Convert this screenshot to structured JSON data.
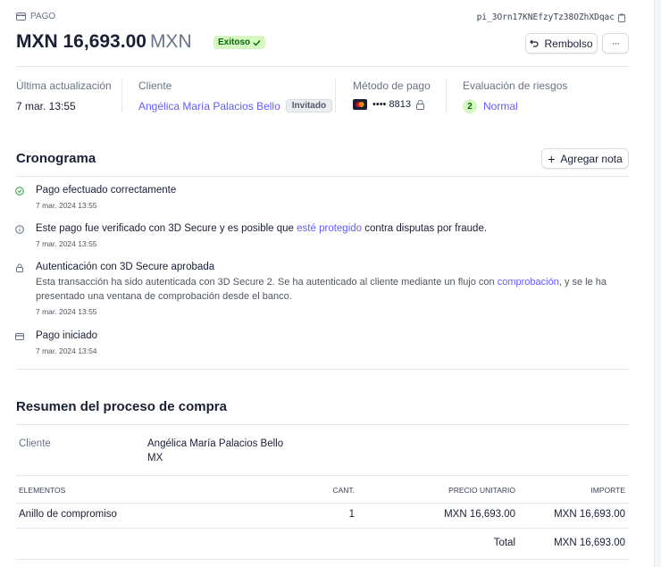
{
  "header": {
    "label": "PAGO",
    "id": "pi_3Orn17KNEfzyTz38OZhXDqac",
    "amount": "MXN 16,693.00",
    "currency": "MXN",
    "status": "Exitoso",
    "refund_label": "Rembolso",
    "more_label": "···"
  },
  "summary": {
    "updated_label": "Última actualización",
    "updated_value": "7 mar. 13:55",
    "client_label": "Cliente",
    "client_name": "Angélica María Palacios Bello",
    "client_badge": "Invitado",
    "method_label": "Método de pago",
    "method_value": "•••• 8813",
    "risk_label": "Evaluación de riesgos",
    "risk_score": "2",
    "risk_value": "Normal"
  },
  "timeline": {
    "title": "Cronograma",
    "add_note": "Agregar nota",
    "events": [
      {
        "title": "Pago efectuado correctamente",
        "date": "7 mar. 2024 13:55"
      },
      {
        "title_pre": "Este pago fue verificado con 3D Secure y es posible que ",
        "title_link": "esté protegido",
        "title_post": " contra disputas por fraude.",
        "date": "7 mar. 2024 13:55"
      },
      {
        "title": "Autenticación con 3D Secure aprobada",
        "body_pre": "Esta transacción ha sido autenticada con 3D Secure 2. Se ha autenticado al cliente mediante un flujo con ",
        "body_link": "comprobación",
        "body_post": ", y se le ha",
        "body_line2": "presentado una ventana de comprobación desde el banco.",
        "date": "7 mar. 2024 13:55"
      },
      {
        "title": "Pago iniciado",
        "date": "7 mar. 2024 13:54"
      }
    ]
  },
  "checkout": {
    "title": "Resumen del proceso de compra",
    "client_label": "Cliente",
    "client_name": "Angélica María Palacios Bello",
    "client_country": "MX",
    "columns": [
      "ELEMENTOS",
      "CANT.",
      "PRECIO UNITARIO",
      "IMPORTE"
    ],
    "items": [
      {
        "name": "Anillo de compromiso",
        "qty": "1",
        "unit": "MXN 16,693.00",
        "total": "MXN 16,693.00"
      }
    ],
    "total_label": "Total",
    "total_value": "MXN 16,693.00"
  },
  "colors": {
    "accent": "#635bff",
    "success_bg": "#d7f7c2",
    "success_fg": "#05690d"
  }
}
